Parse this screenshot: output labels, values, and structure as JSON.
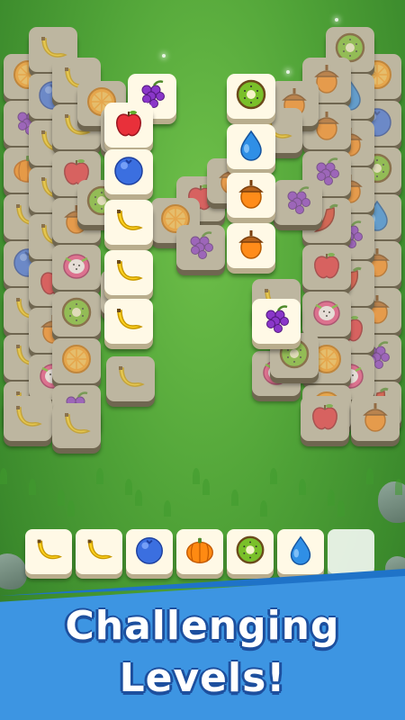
{
  "game": {
    "headline_line1": "Challenging",
    "headline_line2": "Levels!",
    "colors": {
      "background_green": "#4fa237",
      "banner_blue": "#3d95e2",
      "tile_face": "#f8f1dc",
      "headline_text": "#ffffff"
    }
  },
  "board": {
    "left_stack_tiles": [
      "orange",
      "grapes",
      "pumpkin",
      "banana",
      "blueberry",
      "banana",
      "banana",
      "banana",
      "apple",
      "acorn",
      "dragonfruit",
      "kiwi"
    ],
    "right_stack_tiles": [
      "orange",
      "blueberry",
      "kiwi",
      "water-drop",
      "acorn",
      "acorn",
      "grapes",
      "chili",
      "apple",
      "dragonfruit",
      "orange"
    ],
    "top_tiles": [
      "grapes",
      "kiwi",
      "apple",
      "water-drop",
      "blueberry",
      "banana",
      "acorn",
      "banana",
      "acorn",
      "banana",
      "grapes",
      "banana"
    ]
  },
  "tray": {
    "capacity": 7,
    "slots": [
      "banana",
      "banana",
      "blueberry",
      "pumpkin",
      "kiwi",
      "water-drop",
      ""
    ]
  }
}
